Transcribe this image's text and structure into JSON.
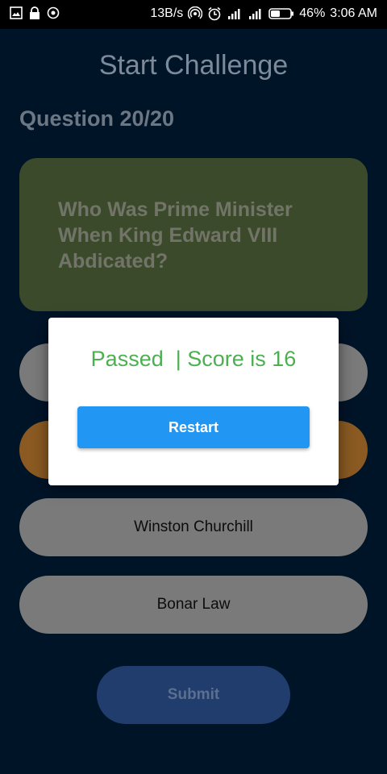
{
  "status_bar": {
    "net_speed": "13B/s",
    "battery_pct": "46%",
    "time": "3:06 AM",
    "icons_left": [
      "image-icon",
      "lock-icon",
      "target-icon"
    ],
    "icons_right": [
      "hotspot-icon",
      "alarm-icon",
      "signal-icon",
      "signal-icon",
      "battery-icon"
    ]
  },
  "screen": {
    "title": "Start Challenge",
    "question_counter": "Question 20/20",
    "question_text": "Who Was Prime Minister When King Edward VIII Abdicated?"
  },
  "options": [
    {
      "label": "",
      "selected": false
    },
    {
      "label": "",
      "selected": true
    },
    {
      "label": "Winston Churchill",
      "selected": false
    },
    {
      "label": "Bonar Law",
      "selected": false
    }
  ],
  "submit_label": "Submit",
  "dialog": {
    "result_text": "Passed  | Score is 16",
    "restart_label": "Restart"
  },
  "colors": {
    "background": "#001428",
    "question_card": "#3c4a2c",
    "option": "#7a7a7a",
    "option_selected": "#8a5a22",
    "submit": "#213d6e",
    "result_green": "#4caf50",
    "restart_blue": "#2196f3"
  }
}
